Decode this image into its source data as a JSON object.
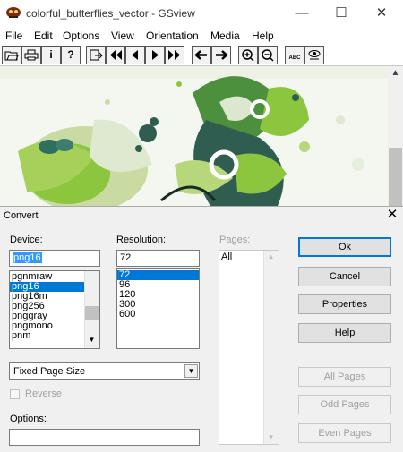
{
  "window": {
    "title": "colorful_butterflies_vector - GSview",
    "minimize": "—",
    "maximize": "☐",
    "close": "✕"
  },
  "menu": [
    "File",
    "Edit",
    "Options",
    "View",
    "Orientation",
    "Media",
    "Help"
  ],
  "toolbar": {
    "info_label": "i",
    "help_label": "?",
    "magnify_label": "ABC"
  },
  "dialog": {
    "title": "Convert",
    "close": "✕",
    "device": {
      "label": "Device:",
      "value": "png16",
      "items": [
        "pgnmraw",
        "png16",
        "png16m",
        "png256",
        "pnggray",
        "pngmono",
        "pnm"
      ],
      "selected_index": 1
    },
    "resolution": {
      "label": "Resolution:",
      "value": "72",
      "items": [
        "72",
        "96",
        "120",
        "300",
        "600"
      ],
      "selected_index": 0
    },
    "pages": {
      "label": "Pages:",
      "items": [
        "All"
      ]
    },
    "page_size": {
      "value": "Fixed Page Size"
    },
    "reverse": {
      "label": "Reverse",
      "checked": false
    },
    "options": {
      "label": "Options:",
      "value": ""
    },
    "buttons": {
      "ok": "Ok",
      "cancel": "Cancel",
      "properties": "Properties",
      "help": "Help",
      "all_pages": "All Pages",
      "odd_pages": "Odd Pages",
      "even_pages": "Even Pages"
    }
  },
  "colors": {
    "selection": "#0078d7",
    "butterfly_green": "#8cc63f",
    "dark_teal": "#2f5d50",
    "disabled_text": "#a0a0a0"
  }
}
